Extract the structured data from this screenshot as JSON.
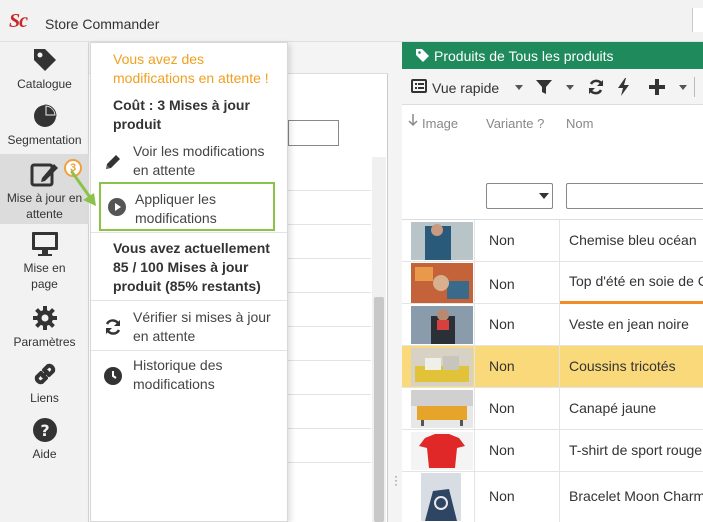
{
  "app": {
    "logo": "Sc",
    "title": "Store Commander"
  },
  "sidebar": {
    "items": [
      {
        "label": "Catalogue",
        "icon": "tag-icon"
      },
      {
        "label": "Segmentation",
        "icon": "pie-chart-icon"
      },
      {
        "label": "Mise à jour en attente",
        "icon": "edit-icon",
        "badge": "3"
      },
      {
        "label": "Mise en page",
        "icon": "monitor-icon"
      },
      {
        "label": "Paramètres",
        "icon": "gear-icon"
      },
      {
        "label": "Liens",
        "icon": "link-icon"
      },
      {
        "label": "Aide",
        "icon": "help-icon"
      }
    ]
  },
  "dropdown": {
    "pending_title": "Vous avez des modifications en attente !",
    "cost": "Coût : 3 Mises à jour produit",
    "items": [
      {
        "label": "Voir les modifications en attente",
        "icon": "pencil-icon"
      },
      {
        "label": "Appliquer les modifications",
        "icon": "play-icon"
      },
      {
        "label": "Vérifier si mises à jour en attente",
        "icon": "refresh-icon"
      },
      {
        "label": "Historique des modifications",
        "icon": "clock-icon"
      }
    ],
    "current_status": "Vous avez actuellement 85 / 100 Mises à jour produit (85% restants)"
  },
  "products_panel": {
    "title": "Produits de Tous les produits",
    "toolbar": {
      "view_label": "Vue rapide"
    },
    "columns": {
      "image": "Image",
      "variant": "Variante ?",
      "name": "Nom"
    },
    "rows": [
      {
        "variant": "Non",
        "name": "Chemise bleu océan",
        "selected": false
      },
      {
        "variant": "Non",
        "name": "Top d'été en soie de C",
        "selected": false
      },
      {
        "variant": "Non",
        "name": "Veste en jean noire",
        "selected": false
      },
      {
        "variant": "Non",
        "name": "Coussins tricotés",
        "selected": true
      },
      {
        "variant": "Non",
        "name": "Canapé jaune",
        "selected": false
      },
      {
        "variant": "Non",
        "name": "T-shirt de sport rouge",
        "selected": false
      },
      {
        "variant": "Non",
        "name": "Bracelet Moon Charm",
        "selected": false
      }
    ]
  },
  "colors": {
    "brand_red": "#c62828",
    "header_green": "#1f8a5b",
    "pending_orange": "#f0a020",
    "highlight_green": "#8bc34a",
    "selected_row": "#fad97a"
  }
}
